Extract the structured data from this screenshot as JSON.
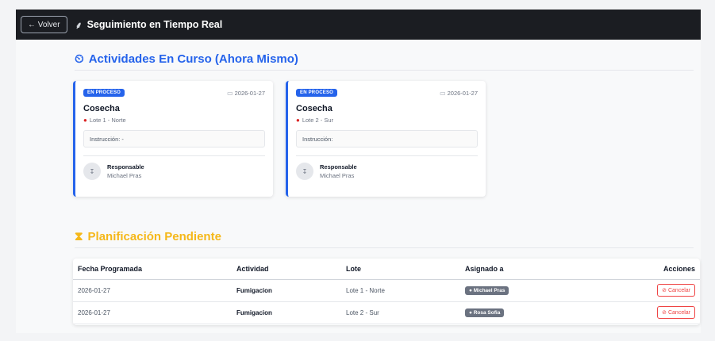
{
  "header": {
    "back_label": "← Volver",
    "title": "Seguimiento en Tiempo Real",
    "title_icon": "sprout-icon"
  },
  "current": {
    "heading": "Actividades En Curso (Ahora Mismo)",
    "heading_icon": "clock-icon",
    "cards": [
      {
        "status": "EN PROCESO",
        "date": "2026-01-27",
        "activity": "Cosecha",
        "lote": "Lote 1 - Norte",
        "instruction": "Instrucción: -",
        "resp_label": "Responsable",
        "resp_name": "Michael Pras"
      },
      {
        "status": "EN PROCESO",
        "date": "2026-01-27",
        "activity": "Cosecha",
        "lote": "Lote 2 - Sur",
        "instruction": "Instrucción:",
        "resp_label": "Responsable",
        "resp_name": "Michael Pras"
      }
    ]
  },
  "pending": {
    "heading": "Planificación Pendiente",
    "heading_icon": "hourglass-icon",
    "columns": [
      "Fecha Programada",
      "Actividad",
      "Lote",
      "Asignado a",
      "Acciones"
    ],
    "rows": [
      {
        "date": "2026-01-27",
        "activity": "Fumigacion",
        "lote": "Lote 1 - Norte",
        "assignee": "Michael Pras",
        "action": "Cancelar"
      },
      {
        "date": "2026-01-27",
        "activity": "Fumigacion",
        "lote": "Lote 2 - Sur",
        "assignee": "Rosa Sofia",
        "action": "Cancelar"
      }
    ]
  },
  "colors": {
    "accent": "#2563eb",
    "pending": "#f5b81a",
    "danger": "#ef4444",
    "header_bg": "#1b1d22"
  }
}
